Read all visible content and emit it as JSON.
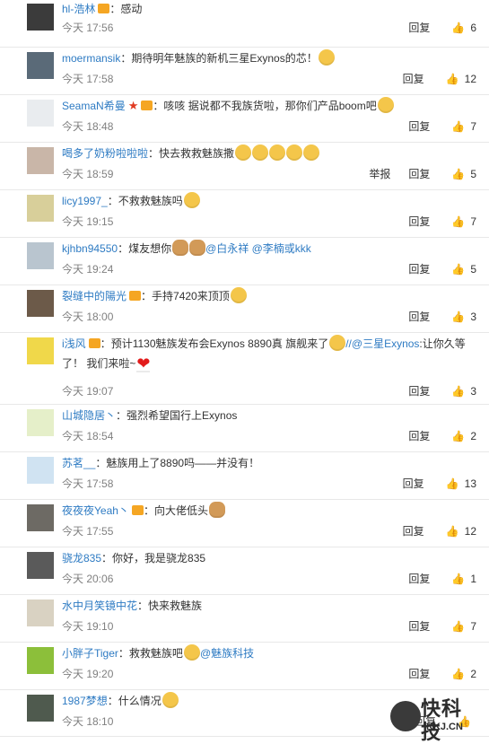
{
  "actions": {
    "reply": "回复",
    "report": "举报"
  },
  "colors": {
    "username": "#2e7bc3",
    "time": "#808080",
    "badge": "#f5a623"
  },
  "watermark": {
    "title": "快科技",
    "sub": "KKJ.CN",
    "icon": "kkj-logo-icon"
  },
  "comments": [
    {
      "user": "hl-浩林",
      "badge": true,
      "star": false,
      "text": "感动",
      "emoji": [],
      "time": "今天 17:56",
      "likes": "6",
      "report": false
    },
    {
      "user": "moermansik",
      "badge": false,
      "star": false,
      "text": "期待明年魅族的新机三星Exynos的芯！",
      "emoji": [
        "face"
      ],
      "time": "今天 17:58",
      "likes": "12",
      "report": false
    },
    {
      "user": "SeamaN希曼",
      "badge": true,
      "star": true,
      "text": "咳咳   据说都不我族货啦，那你们产品boom吧",
      "emoji": [
        "face"
      ],
      "time": "今天 18:48",
      "likes": "7",
      "report": false
    },
    {
      "user": "喝多了奶粉啦啦啦",
      "badge": false,
      "star": false,
      "text": "快去救救魅族撒",
      "emoji": [
        "face",
        "face",
        "face",
        "face",
        "face"
      ],
      "time": "今天 18:59",
      "likes": "5",
      "report": true
    },
    {
      "user": "licy1997_",
      "badge": false,
      "star": false,
      "text": "不救救魅族吗",
      "emoji": [
        "face"
      ],
      "time": "今天 19:15",
      "likes": "7",
      "report": false
    },
    {
      "user": "kjhbn94550",
      "badge": false,
      "star": false,
      "text": "煤友想你",
      "emoji": [
        "dog",
        "dog"
      ],
      "mentions": "@白永祥 @李楠或kkk",
      "time": "今天 19:24",
      "likes": "5",
      "report": false
    },
    {
      "user": "裂缝中的陽光",
      "badge": true,
      "star": false,
      "text": "手持7420来顶顶",
      "emoji": [
        "face"
      ],
      "time": "今天 18:00",
      "likes": "3",
      "report": false
    },
    {
      "user": "i浅风",
      "badge": true,
      "star": false,
      "text": "预计1130魅族发布会Exynos 8890真 旗舰来了",
      "emoji": [
        "face"
      ],
      "mentions": "//@三星Exynos",
      "text2": ":让你久等",
      "line2": "了！ 我们来啦~",
      "time": "今天 19:07",
      "likes": "3",
      "report": false
    },
    {
      "user": "山城隐居丶",
      "badge": false,
      "star": false,
      "text": "强烈希望国行上Exynos",
      "emoji": [],
      "time": "今天 18:54",
      "likes": "2",
      "report": false
    },
    {
      "user": "苏茗__",
      "badge": false,
      "star": false,
      "text": "魅族用上了8890吗——并没有！",
      "emoji": [],
      "time": "今天 17:58",
      "likes": "13",
      "report": false
    },
    {
      "user": "夜夜夜Yeah丶",
      "badge": true,
      "star": false,
      "text": "向大佬低头",
      "emoji": [
        "dog"
      ],
      "time": "今天 17:55",
      "likes": "12",
      "report": false
    },
    {
      "user": "骁龙835",
      "badge": false,
      "star": false,
      "text": "你好，我是骁龙835",
      "emoji": [],
      "time": "今天 20:06",
      "likes": "1",
      "report": false
    },
    {
      "user": "水中月笑镜中花",
      "badge": false,
      "star": false,
      "text": "快来救魅族",
      "emoji": [],
      "time": "今天 19:10",
      "likes": "7",
      "report": false
    },
    {
      "user": "小胖子Tiger",
      "badge": false,
      "star": false,
      "text": "救救魅族吧",
      "emoji": [
        "face"
      ],
      "mentions": "@魅族科技",
      "time": "今天 19:20",
      "likes": "2",
      "report": false
    },
    {
      "user": "1987梦想",
      "badge": false,
      "star": false,
      "text": "什么情况",
      "emoji": [
        "face"
      ],
      "time": "今天 18:10",
      "likes": "",
      "report": false
    }
  ]
}
